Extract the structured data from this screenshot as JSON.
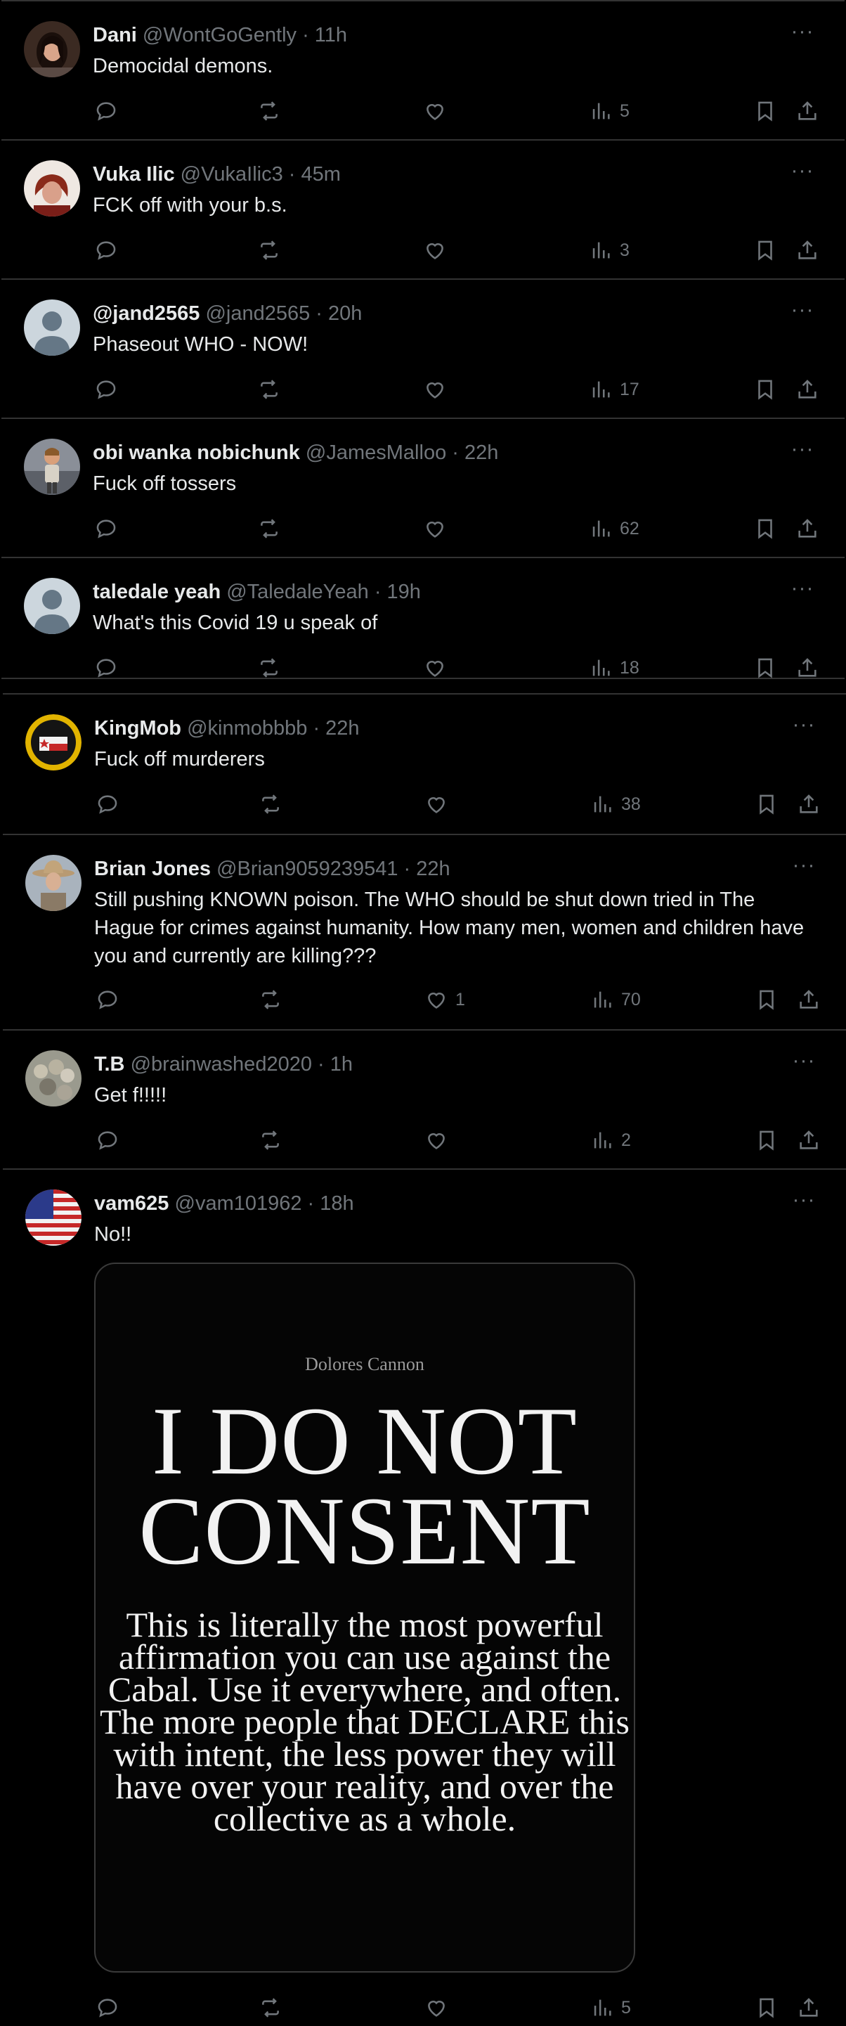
{
  "colors": {
    "background": "#000000",
    "text": "#e7e9ea",
    "muted": "#71767b",
    "divider": "#333333"
  },
  "tweets": [
    {
      "name": "Dani",
      "handle": "@WontGoGently",
      "time": "11h",
      "text": "Democidal demons.",
      "likes": "",
      "views": "5",
      "avatar": "avatar-woman-dark-hair"
    },
    {
      "name": "Vuka Ilic",
      "handle": "@VukaIlic3",
      "time": "45m",
      "text": "FCK off with your b.s.",
      "likes": "",
      "views": "3",
      "avatar": "avatar-woman-red-hair"
    },
    {
      "name": "@jand2565",
      "handle": "@jand2565",
      "time": "20h",
      "text": "Phaseout WHO - NOW!",
      "likes": "",
      "views": "17",
      "avatar": "avatar-default"
    },
    {
      "name": "obi wanka nobichunk",
      "handle": "@JamesMalloo",
      "time": "22h",
      "text": "Fuck off tossers",
      "likes": "",
      "views": "62",
      "avatar": "avatar-figure"
    },
    {
      "name": "taledale yeah",
      "handle": "@TaledaleYeah",
      "time": "19h",
      "text": "What's this Covid 19 u speak of",
      "likes": "",
      "views": "18",
      "avatar": "avatar-default"
    },
    {
      "name": "KingMob",
      "handle": "@kinmobbbb",
      "time": "22h",
      "text": "Fuck off murderers",
      "likes": "",
      "views": "38",
      "avatar": "avatar-badge"
    },
    {
      "name": "Brian Jones",
      "handle": "@Brian9059239541",
      "time": "22h",
      "text": "Still pushing KNOWN poison. The WHO should be shut down tried in The Hague for crimes against humanity. How many men, women and children have you and currently are killing???",
      "likes": "1",
      "views": "70",
      "avatar": "avatar-cowboy-hat"
    },
    {
      "name": "T.B",
      "handle": "@brainwashed2020",
      "time": "1h",
      "text": "Get f!!!!!",
      "likes": "",
      "views": "2",
      "avatar": "avatar-crowd"
    },
    {
      "name": "vam625",
      "handle": "@vam101962",
      "time": "18h",
      "text": "No!!",
      "likes": "",
      "views": "5",
      "avatar": "avatar-us-flag"
    }
  ],
  "media": {
    "author": "Dolores Cannon",
    "headline_line1": "I DO NOT",
    "headline_line2": "CONSENT",
    "body": "This is literally the most powerful affirmation you can use against the Cabal. Use it everywhere, and often. The more people that DECLARE this with intent, the less power they will have over your reality, and over the collective as a whole."
  },
  "icons": {
    "more": "more-horizontal-icon",
    "reply": "reply-icon",
    "retweet": "retweet-icon",
    "like": "heart-icon",
    "views": "views-icon",
    "bookmark": "bookmark-icon",
    "share": "share-icon"
  }
}
